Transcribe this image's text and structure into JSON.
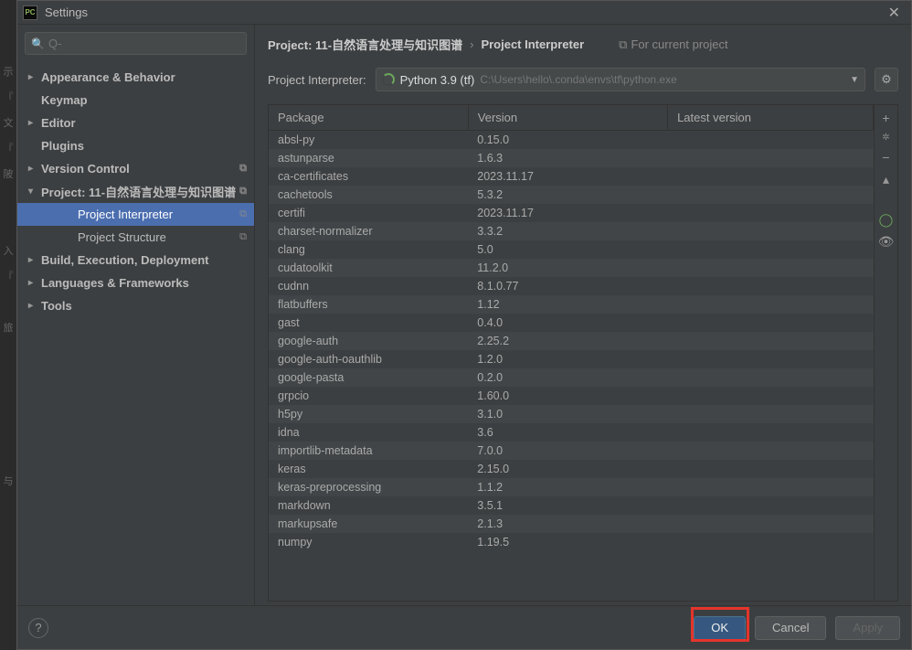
{
  "titlebar": {
    "title": "Settings"
  },
  "search": {
    "placeholder": "Q-"
  },
  "sidebar": {
    "items": [
      {
        "label": "Appearance & Behavior",
        "arrow": "▸",
        "bold": true
      },
      {
        "label": "Keymap",
        "arrow": "",
        "bold": true
      },
      {
        "label": "Editor",
        "arrow": "▸",
        "bold": true
      },
      {
        "label": "Plugins",
        "arrow": "",
        "bold": true
      },
      {
        "label": "Version Control",
        "arrow": "▸",
        "bold": true,
        "badge": "⧉"
      },
      {
        "label": "Project: 11-自然语言处理与知识图谱",
        "arrow": "▾",
        "bold": true,
        "badge": "⧉"
      },
      {
        "label": "Project Interpreter",
        "arrow": "",
        "bold": false,
        "grandchild": true,
        "selected": true,
        "badge": "⧉"
      },
      {
        "label": "Project Structure",
        "arrow": "",
        "bold": false,
        "grandchild": true,
        "badge": "⧉"
      },
      {
        "label": "Build, Execution, Deployment",
        "arrow": "▸",
        "bold": true
      },
      {
        "label": "Languages & Frameworks",
        "arrow": "▸",
        "bold": true
      },
      {
        "label": "Tools",
        "arrow": "▸",
        "bold": true
      }
    ]
  },
  "breadcrumb": {
    "crumb1": "Project: 11-自然语言处理与知识图谱",
    "sep": "›",
    "crumb2": "Project Interpreter",
    "hint_icon": "⧉",
    "hint_text": "For current project"
  },
  "interpreter": {
    "label": "Project Interpreter:",
    "name": "Python 3.9 (tf)",
    "path": "C:\\Users\\hello\\.conda\\envs\\tf\\python.exe"
  },
  "columns": {
    "pkg": "Package",
    "ver": "Version",
    "latest": "Latest version"
  },
  "packages": [
    {
      "n": "absl-py",
      "v": "0.15.0"
    },
    {
      "n": "astunparse",
      "v": "1.6.3"
    },
    {
      "n": "ca-certificates",
      "v": "2023.11.17"
    },
    {
      "n": "cachetools",
      "v": "5.3.2"
    },
    {
      "n": "certifi",
      "v": "2023.11.17"
    },
    {
      "n": "charset-normalizer",
      "v": "3.3.2"
    },
    {
      "n": "clang",
      "v": "5.0"
    },
    {
      "n": "cudatoolkit",
      "v": "11.2.0"
    },
    {
      "n": "cudnn",
      "v": "8.1.0.77"
    },
    {
      "n": "flatbuffers",
      "v": "1.12"
    },
    {
      "n": "gast",
      "v": "0.4.0"
    },
    {
      "n": "google-auth",
      "v": "2.25.2"
    },
    {
      "n": "google-auth-oauthlib",
      "v": "1.2.0"
    },
    {
      "n": "google-pasta",
      "v": "0.2.0"
    },
    {
      "n": "grpcio",
      "v": "1.60.0"
    },
    {
      "n": "h5py",
      "v": "3.1.0"
    },
    {
      "n": "idna",
      "v": "3.6"
    },
    {
      "n": "importlib-metadata",
      "v": "7.0.0"
    },
    {
      "n": "keras",
      "v": "2.15.0"
    },
    {
      "n": "keras-preprocessing",
      "v": "1.1.2"
    },
    {
      "n": "markdown",
      "v": "3.5.1"
    },
    {
      "n": "markupsafe",
      "v": "2.1.3"
    },
    {
      "n": "numpy",
      "v": "1.19.5"
    }
  ],
  "side_buttons": {
    "add": "+",
    "remove": "−",
    "up": "▴",
    "refresh": "◯",
    "show": "👁"
  },
  "footer": {
    "ok": "OK",
    "cancel": "Cancel",
    "apply": "Apply"
  },
  "busy_icon": "✲"
}
